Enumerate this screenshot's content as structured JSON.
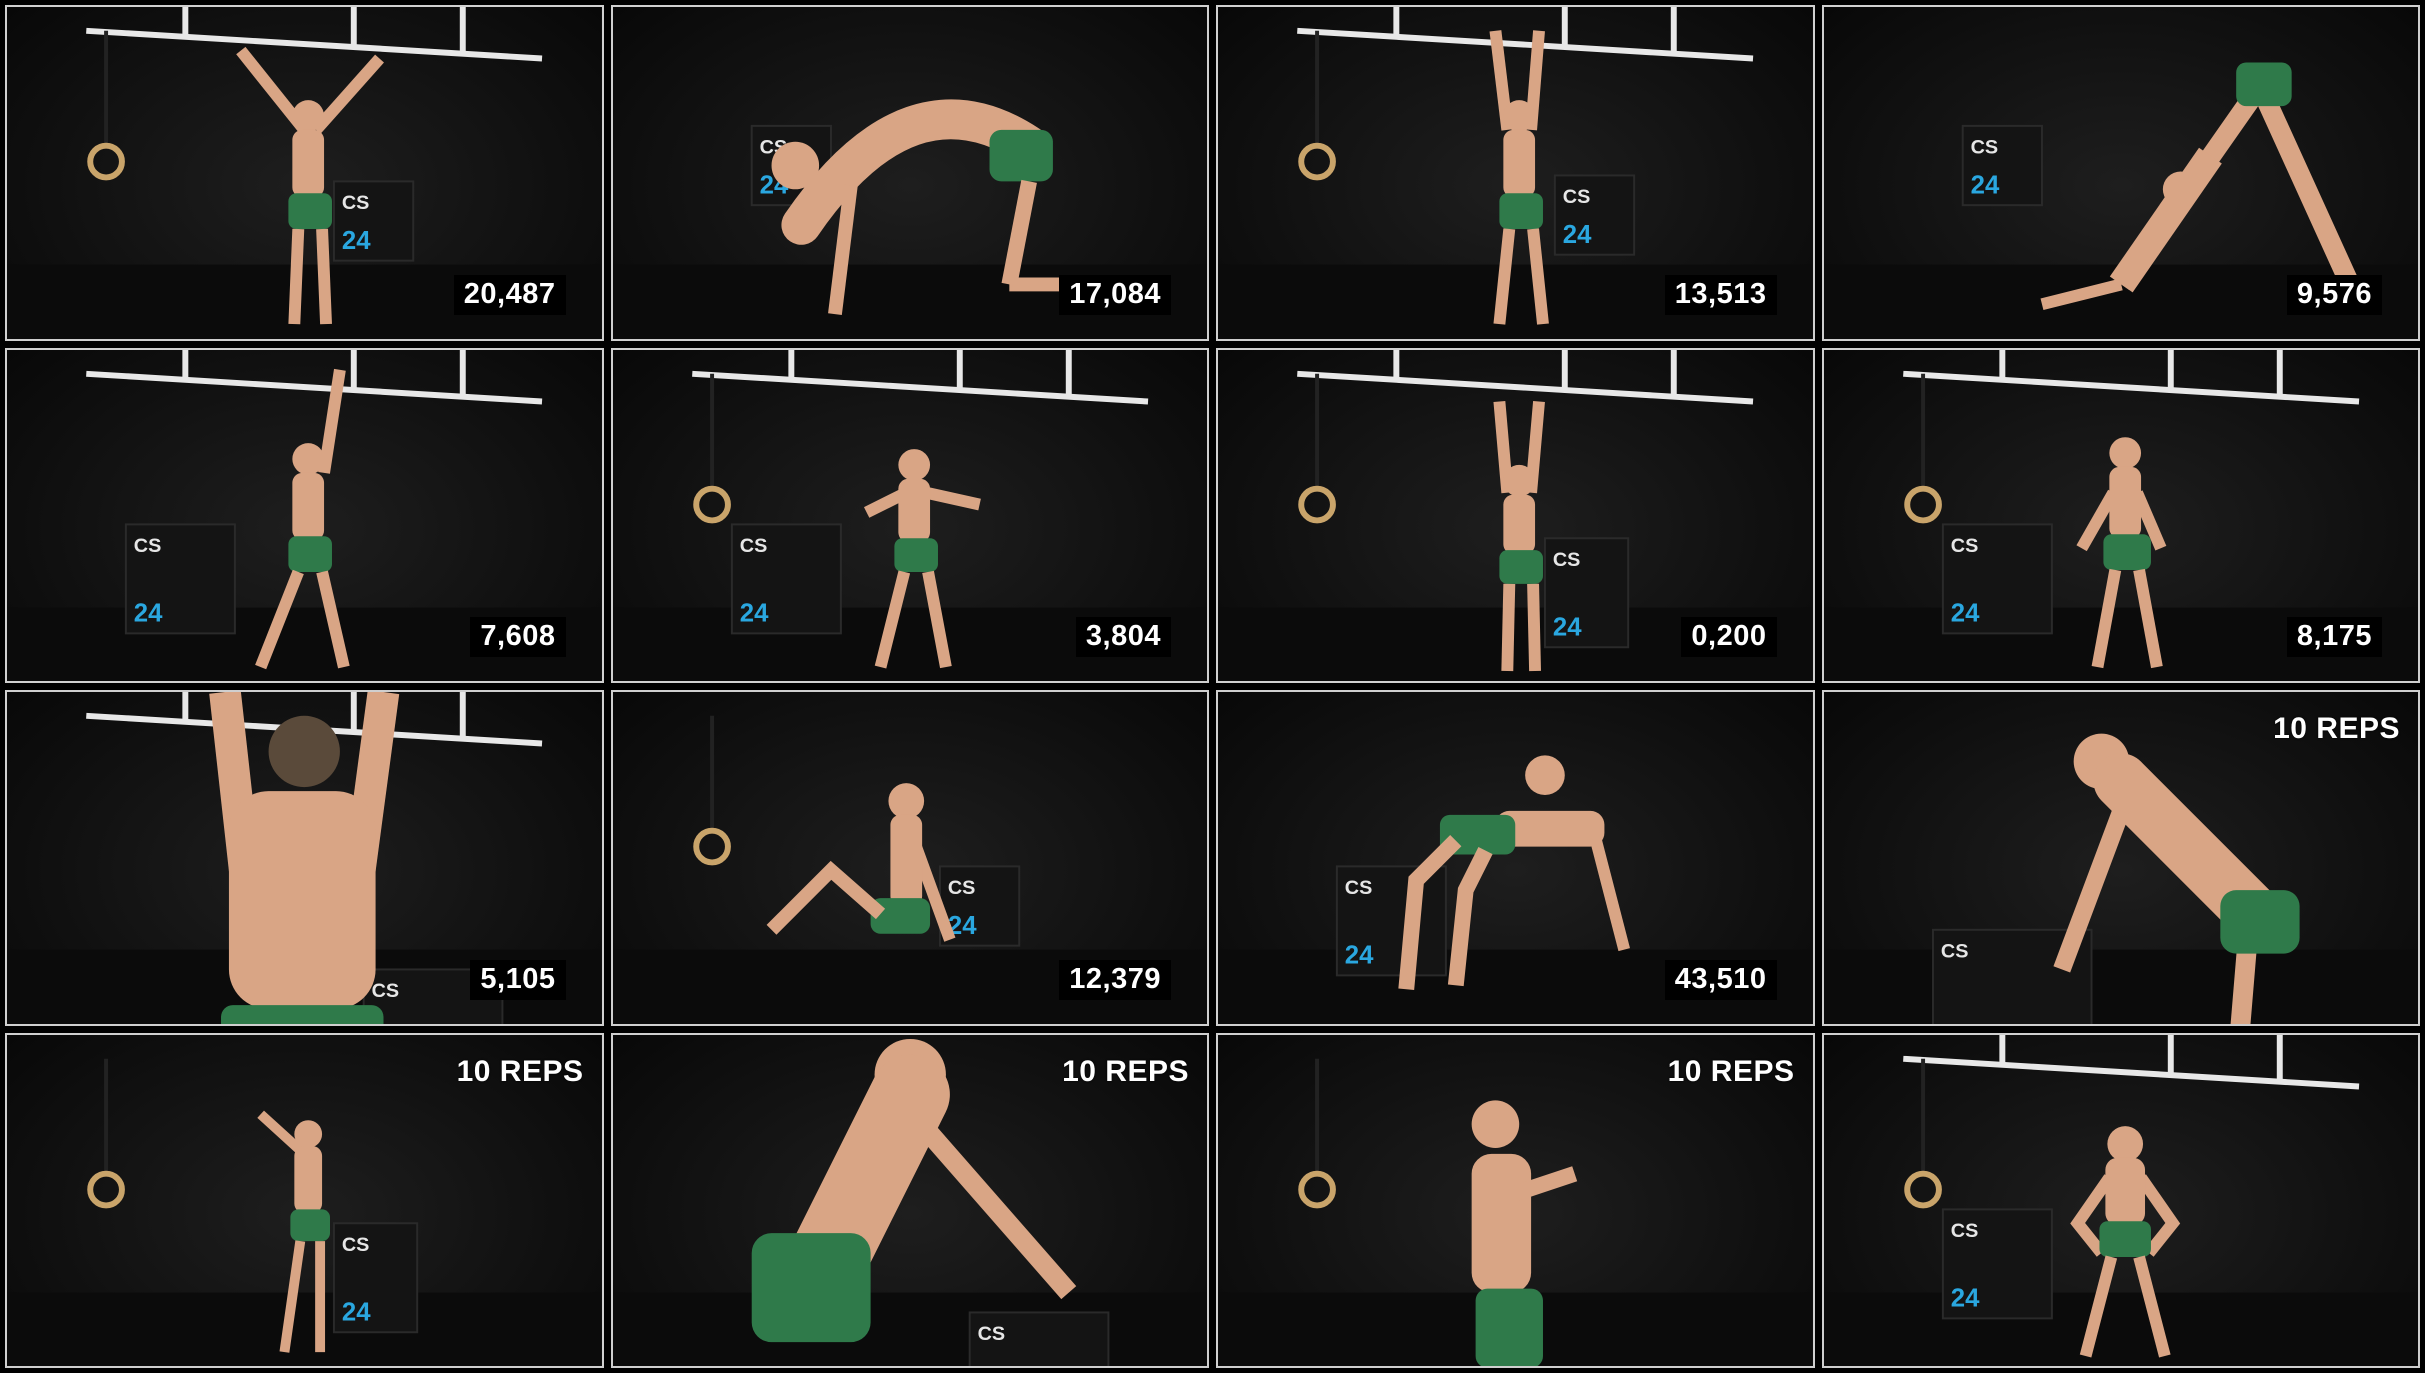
{
  "tiles": [
    {
      "id": "t1",
      "counter": "20,487",
      "reps": "",
      "pose": "hang-wide",
      "bar": true,
      "rings": true,
      "box": "behind"
    },
    {
      "id": "t2",
      "counter": "17,084",
      "reps": "",
      "pose": "cat-cow",
      "bar": false,
      "rings": false,
      "box": "back-left"
    },
    {
      "id": "t3",
      "counter": "13,513",
      "reps": "",
      "pose": "hang-narrow",
      "bar": true,
      "rings": true,
      "box": "behind-right"
    },
    {
      "id": "t4",
      "counter": "9,576",
      "reps": "",
      "pose": "downward-dog",
      "bar": false,
      "rings": false,
      "box": "back-left"
    },
    {
      "id": "t5",
      "counter": "7,608",
      "reps": "",
      "pose": "one-arm-reach",
      "bar": true,
      "rings": false,
      "box": "left"
    },
    {
      "id": "t6",
      "counter": "3,804",
      "reps": "",
      "pose": "arm-circle",
      "bar": true,
      "rings": true,
      "box": "left"
    },
    {
      "id": "t7",
      "counter": "0,200",
      "reps": "",
      "pose": "dead-hang",
      "bar": true,
      "rings": true,
      "box": "right"
    },
    {
      "id": "t8",
      "counter": "8,175",
      "reps": "",
      "pose": "standing-stretch",
      "bar": true,
      "rings": true,
      "box": "left"
    },
    {
      "id": "t9",
      "counter": "5,105",
      "reps": "",
      "pose": "back-hang",
      "bar": true,
      "rings": false,
      "box": "front-right"
    },
    {
      "id": "t10",
      "counter": "12,379",
      "reps": "",
      "pose": "seated-reach",
      "bar": false,
      "rings": true,
      "box": "behind"
    },
    {
      "id": "t11",
      "counter": "43,510",
      "reps": "",
      "pose": "table-top",
      "bar": false,
      "rings": false,
      "box": "left"
    },
    {
      "id": "t12",
      "counter": "",
      "reps": "10 REPS",
      "pose": "box-lean",
      "bar": false,
      "rings": false,
      "box": "front"
    },
    {
      "id": "t13",
      "counter": "",
      "reps": "10 REPS",
      "pose": "ring-row",
      "bar": false,
      "rings": true,
      "box": "right"
    },
    {
      "id": "t14",
      "counter": "",
      "reps": "10 REPS",
      "pose": "box-push",
      "bar": false,
      "rings": false,
      "box": "front-right"
    },
    {
      "id": "t15",
      "counter": "",
      "reps": "10 REPS",
      "pose": "ring-hold",
      "bar": false,
      "rings": true,
      "box": "none"
    },
    {
      "id": "t16",
      "counter": "",
      "reps": "",
      "pose": "squat-stand",
      "bar": true,
      "rings": true,
      "box": "left"
    }
  ],
  "box_label": "CS",
  "box_number": "24",
  "colors": {
    "skin": "#d9a585",
    "shorts": "#2f7a4a",
    "box": "#141414",
    "accent": "#2aa7e0",
    "bar": "#e8e8e8",
    "ring": "#c9a46a"
  }
}
